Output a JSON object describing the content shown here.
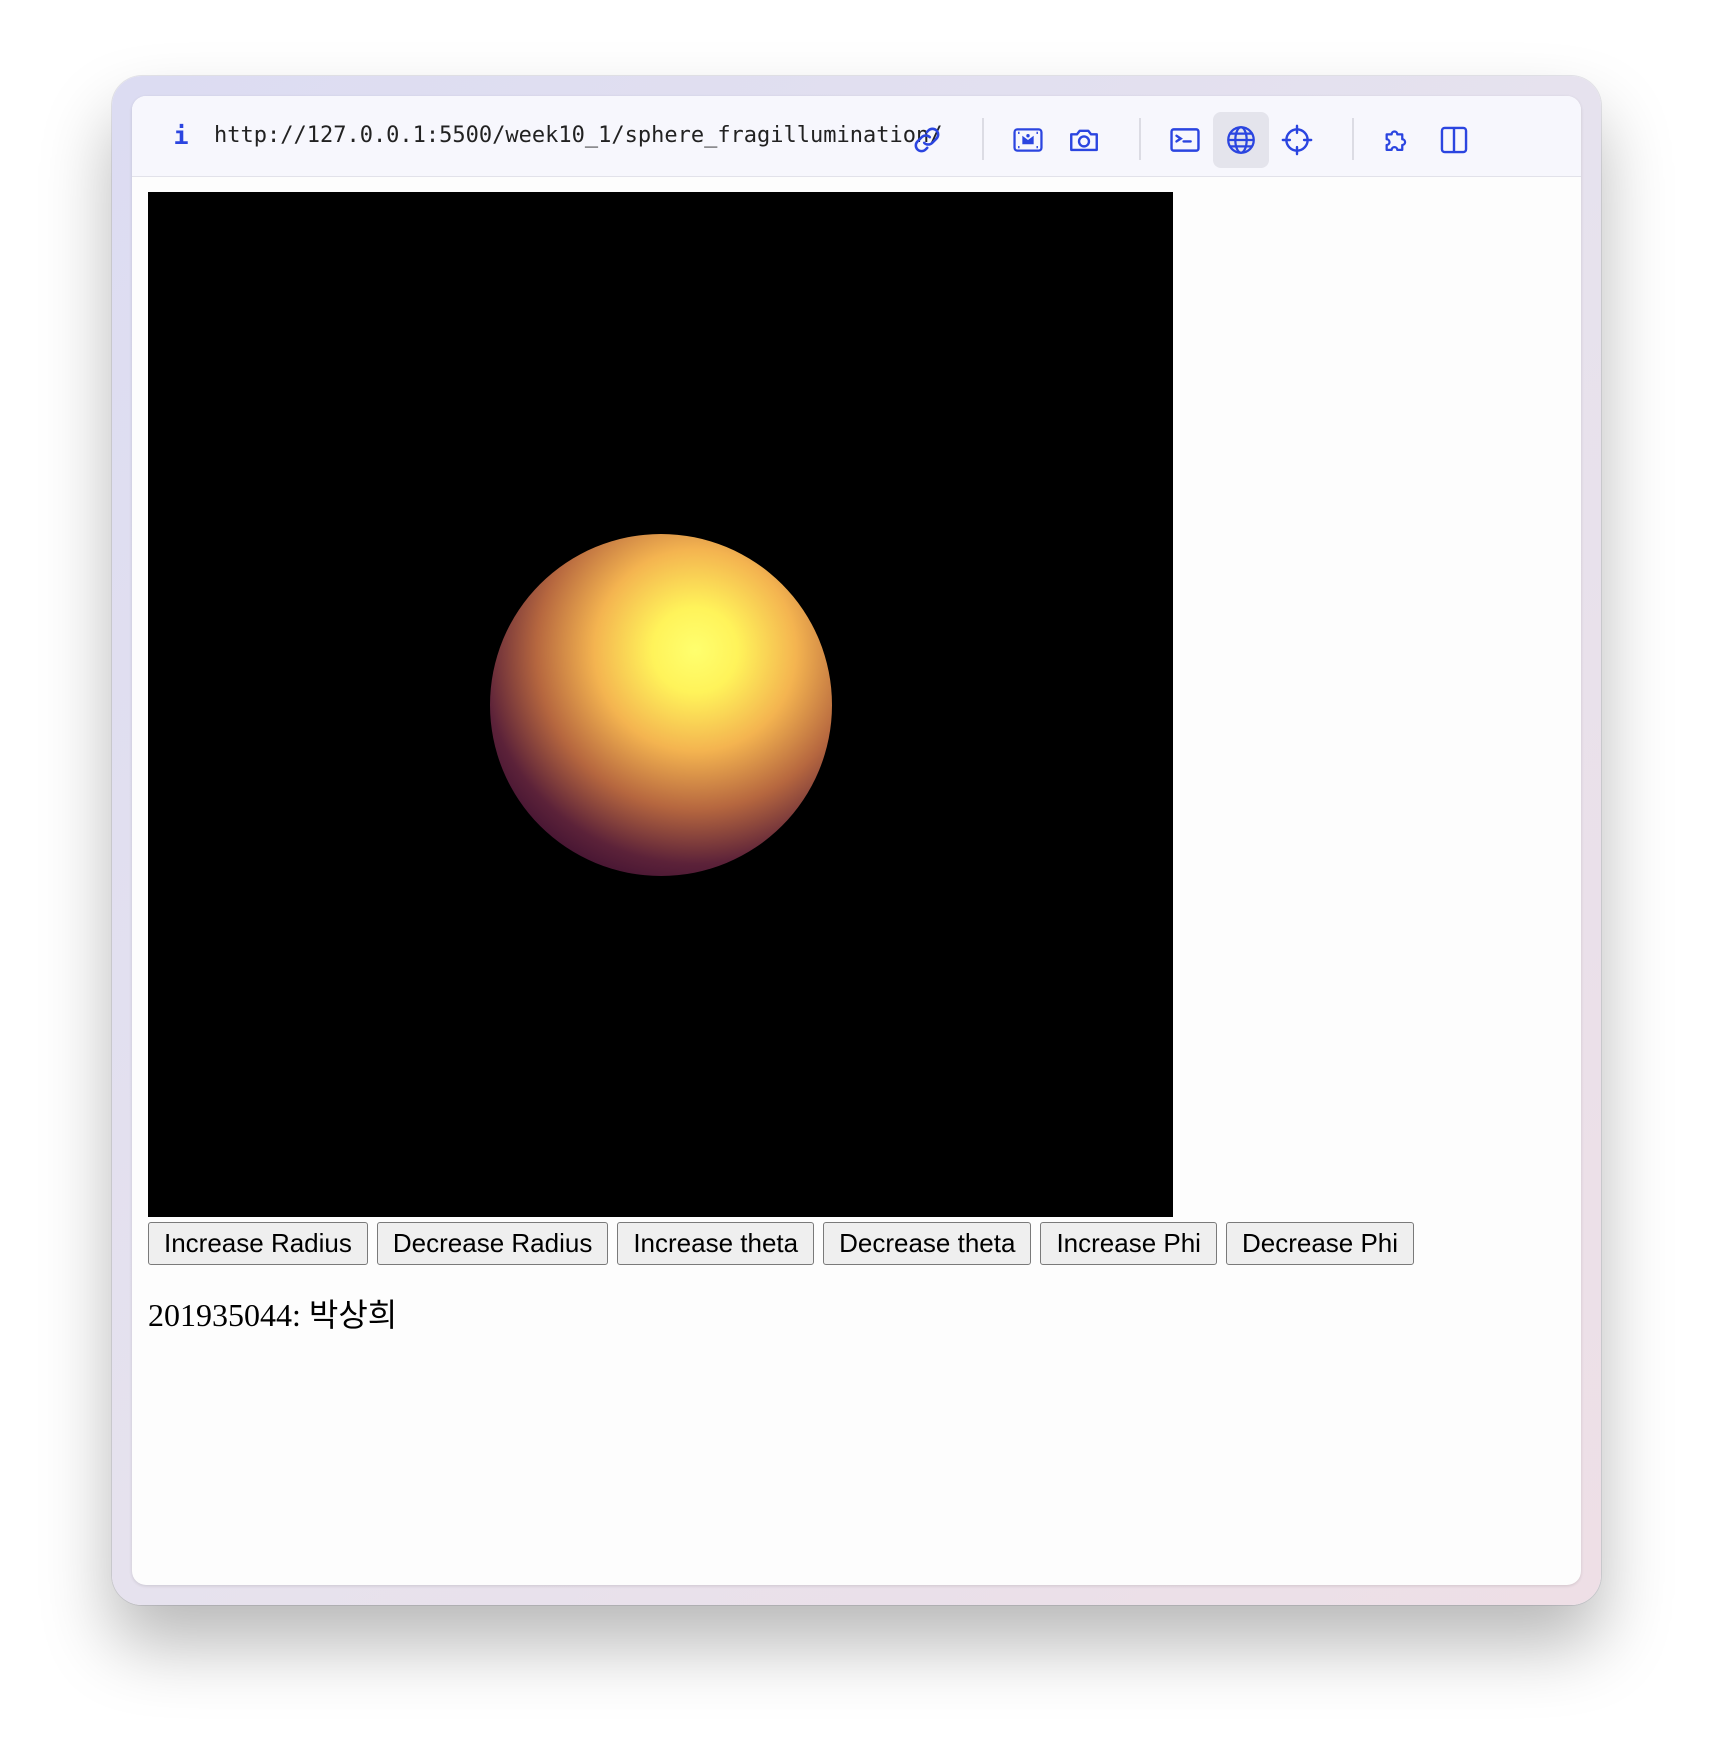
{
  "browser": {
    "info_icon": "info-icon",
    "url": "http://127.0.0.1:5500/week10_1/sphere_fragillumination/",
    "toolbar_icons": [
      "link-icon",
      "image-gallery-icon",
      "camera-icon",
      "terminal-icon",
      "globe-icon",
      "crosshair-icon",
      "puzzle-icon",
      "split-view-icon"
    ],
    "accent_color": "#2b45e0"
  },
  "scene": {
    "background_color": "#000000",
    "sphere_colors": [
      "#ffff6e",
      "#f4b450",
      "#32092d"
    ]
  },
  "controls": {
    "buttons": [
      "Increase Radius",
      "Decrease Radius",
      "Increase theta",
      "Decrease theta",
      "Increase Phi",
      "Decrease Phi"
    ]
  },
  "footer": {
    "caption": "201935044: 박상희"
  }
}
